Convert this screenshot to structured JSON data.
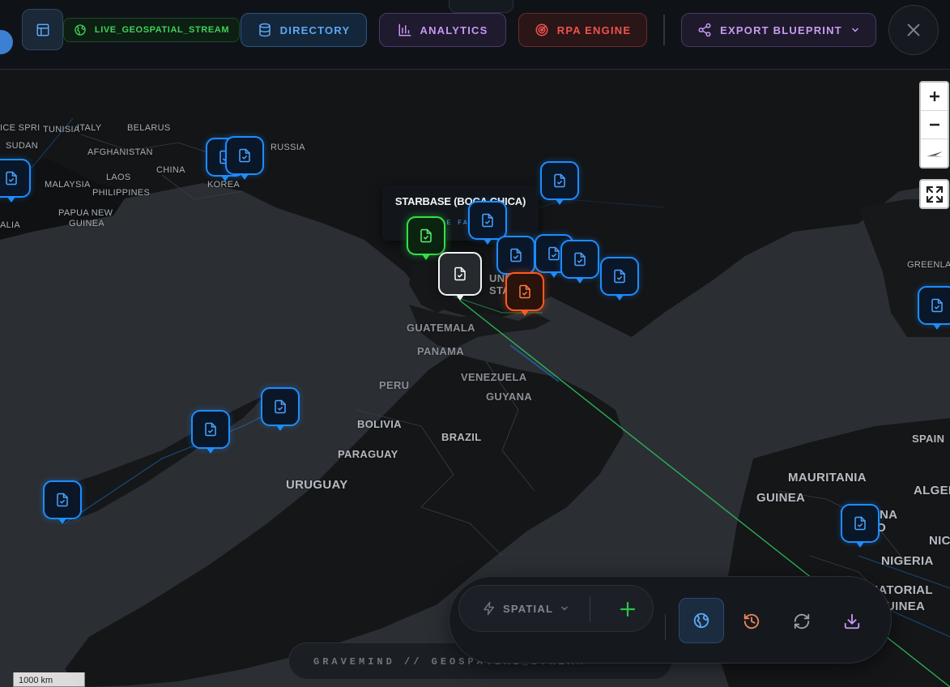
{
  "header": {
    "live_badge": "LIVE_GEOSPATIAL_STREAM",
    "directory_label": "DIRECTORY",
    "analytics_label": "ANALYTICS",
    "rpa_label": "RPA ENGINE",
    "export_label": "EXPORT BLUEPRINT"
  },
  "tooltip": {
    "title": "STARBASE (BOCA CHICA)",
    "subtitle": "E FAC"
  },
  "map_labels": [
    {
      "text": "ICE SPRI",
      "size": "s"
    },
    {
      "text": "TUNISIA",
      "size": "s"
    },
    {
      "text": "ITALY",
      "size": "s"
    },
    {
      "text": "BELARUS",
      "size": "s"
    },
    {
      "text": "RUSSIA",
      "size": "s"
    },
    {
      "text": "SUDAN",
      "size": "s"
    },
    {
      "text": "AFGHANISTAN",
      "size": "s"
    },
    {
      "text": "CHINA",
      "size": "s"
    },
    {
      "text": "KOREA",
      "size": "s"
    },
    {
      "text": "LAOS",
      "size": "s"
    },
    {
      "text": "MALAYSIA",
      "size": "s"
    },
    {
      "text": "PHILIPPINES",
      "size": "s"
    },
    {
      "text": "PAPUA NEW",
      "size": "s"
    },
    {
      "text": "GUINEA",
      "size": "s"
    },
    {
      "text": "ALIA",
      "size": "s"
    },
    {
      "text": "GREENLA",
      "size": "s"
    },
    {
      "text": "UNI",
      "size": "g"
    },
    {
      "text": "STA",
      "size": "g"
    },
    {
      "text": "GUATEMALA",
      "size": "g"
    },
    {
      "text": "PANAMA",
      "size": "g"
    },
    {
      "text": "VENEZUELA",
      "size": "g"
    },
    {
      "text": "GUYANA",
      "size": "g"
    },
    {
      "text": "PERU",
      "size": "g"
    },
    {
      "text": "BOLIVIA",
      "size": "m"
    },
    {
      "text": "BRAZIL",
      "size": "m"
    },
    {
      "text": "PARAGUAY",
      "size": "m"
    },
    {
      "text": "URUGUAY",
      "size": "l"
    },
    {
      "text": "SPAIN",
      "size": "m"
    },
    {
      "text": "MAURITANIA",
      "size": "l"
    },
    {
      "text": "ALGER",
      "size": "l"
    },
    {
      "text": "GUINEA",
      "size": "l"
    },
    {
      "text": "BURKINA",
      "size": "l"
    },
    {
      "text": "FASO",
      "size": "l"
    },
    {
      "text": "NIC",
      "size": "l"
    },
    {
      "text": "NIGERIA",
      "size": "l"
    },
    {
      "text": "EQUATORIAL",
      "size": "l"
    },
    {
      "text": "GUINEA",
      "size": "l"
    }
  ],
  "toolbar": {
    "mode_label": "SPATIAL"
  },
  "brand": "GRAVEMIND // GEOSPATIAL_STREAM",
  "scale_label": "1000 km",
  "colors": {
    "accent_blue": "#1e8cff",
    "accent_green": "#33e04a",
    "accent_orange": "#ff5a1f",
    "accent_purple": "#c897f5",
    "accent_red": "#f0524f"
  }
}
